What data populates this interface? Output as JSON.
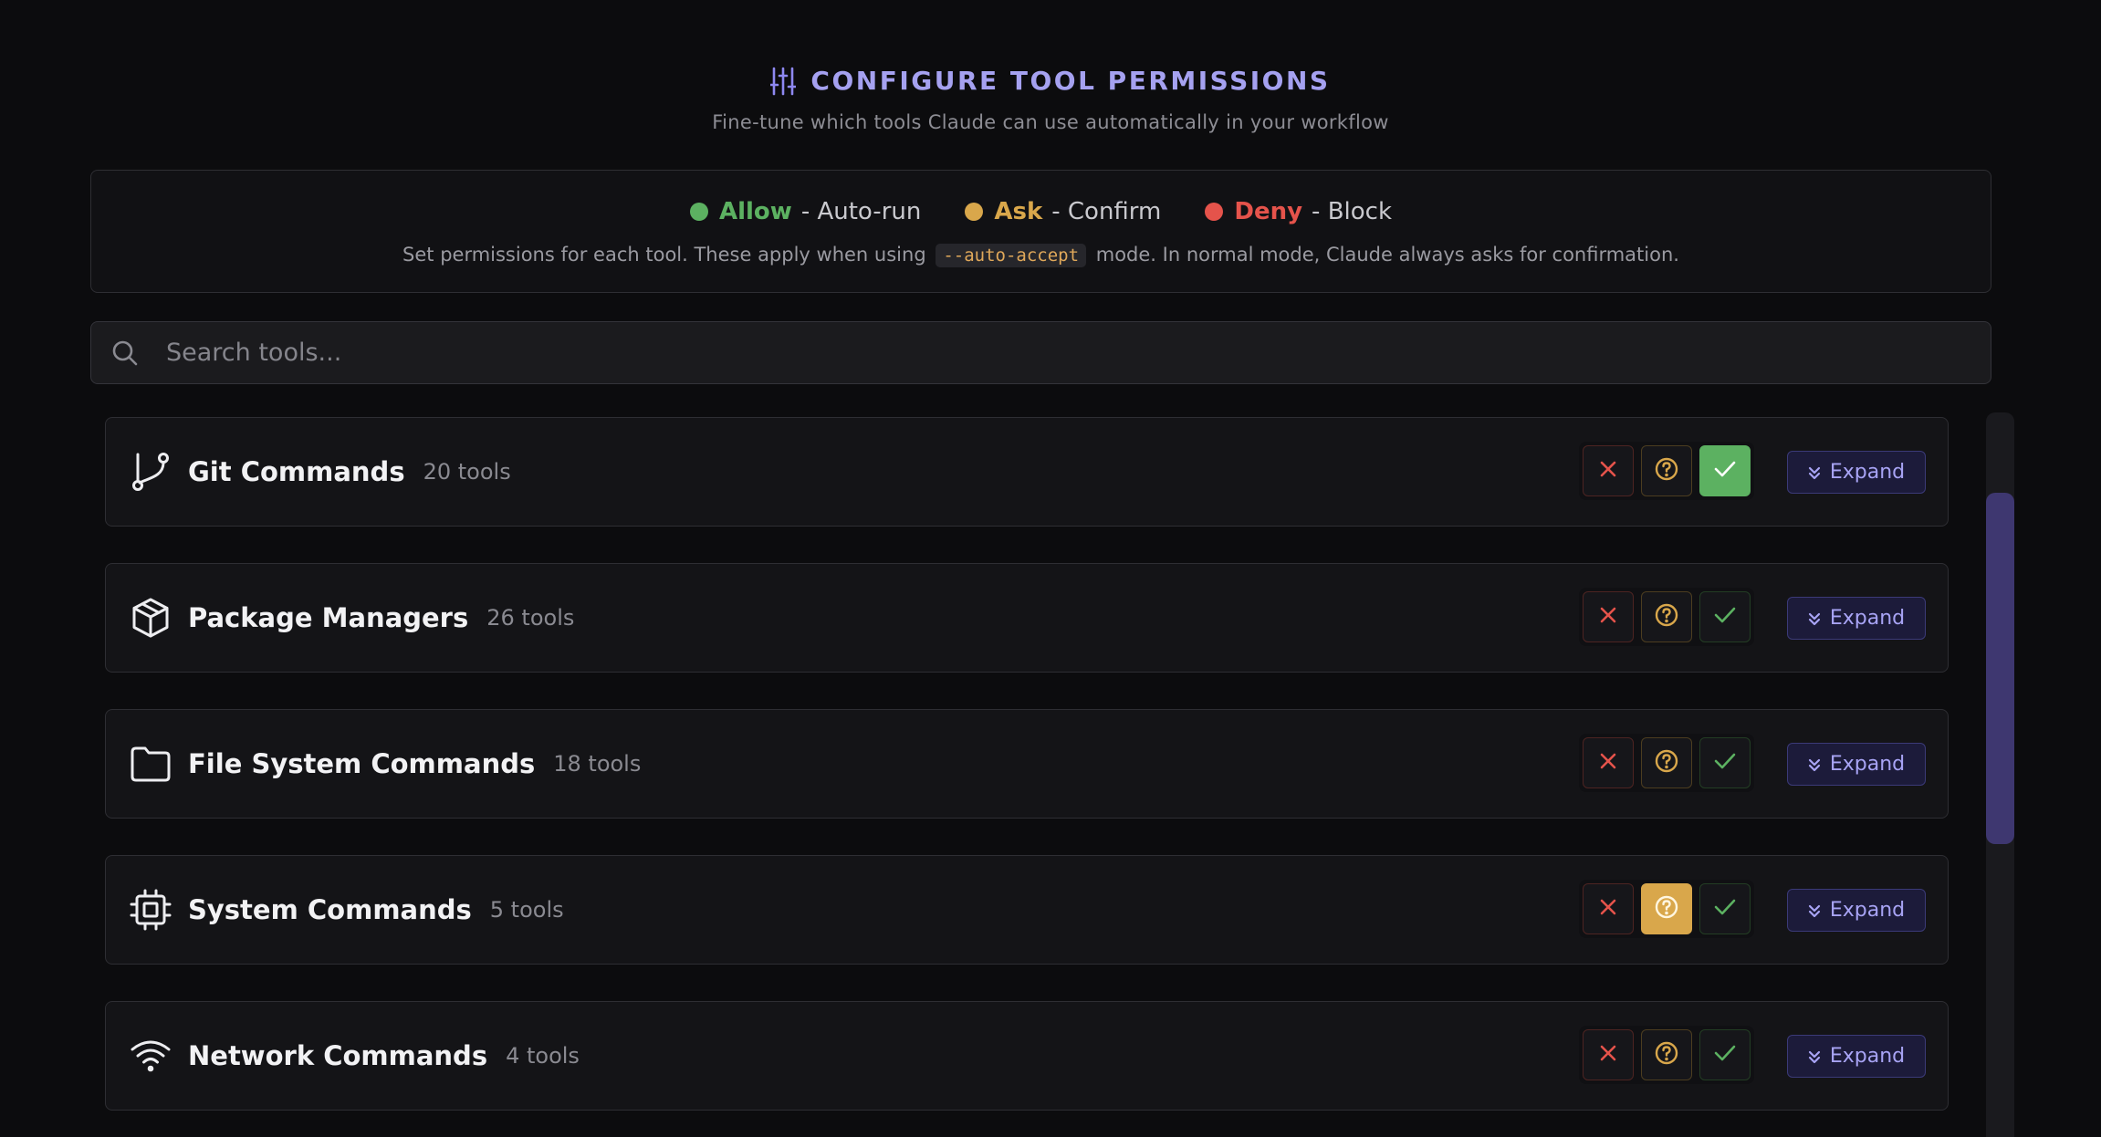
{
  "header": {
    "title": "CONFIGURE TOOL PERMISSIONS",
    "subtitle": "Fine-tune which tools Claude can use automatically in your workflow"
  },
  "legend": {
    "allow_label": "Allow",
    "allow_desc": "- Auto-run",
    "ask_label": "Ask",
    "ask_desc": "- Confirm",
    "deny_label": "Deny",
    "deny_desc": "- Block",
    "note_before": "Set permissions for each tool. These apply when using",
    "note_code": "--auto-accept",
    "note_after": "mode. In normal mode, Claude always asks for confirmation."
  },
  "search": {
    "placeholder": "Search tools...",
    "value": ""
  },
  "expand_label": "Expand",
  "colors": {
    "allow": "#5cb161",
    "ask": "#d9a74b",
    "deny": "#e5534b",
    "accent": "#a5a1f0"
  },
  "categories": [
    {
      "name": "Git Commands",
      "count": "20 tools",
      "icon": "git-branch-icon",
      "selected": "allow"
    },
    {
      "name": "Package Managers",
      "count": "26 tools",
      "icon": "package-icon",
      "selected": "none"
    },
    {
      "name": "File System Commands",
      "count": "18 tools",
      "icon": "folder-icon",
      "selected": "none"
    },
    {
      "name": "System Commands",
      "count": "5 tools",
      "icon": "cpu-icon",
      "selected": "ask"
    },
    {
      "name": "Network Commands",
      "count": "4 tools",
      "icon": "wifi-icon",
      "selected": "none"
    }
  ]
}
